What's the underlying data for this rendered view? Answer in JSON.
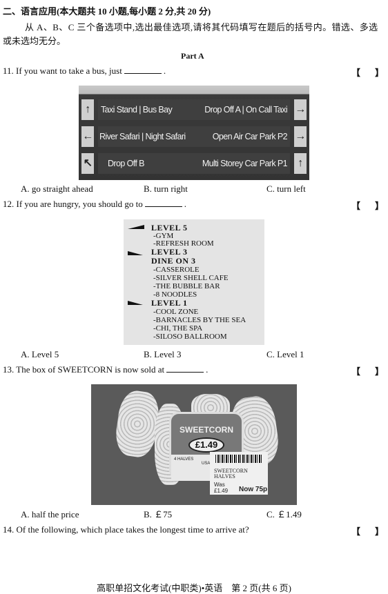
{
  "section_title": "二、语言应用(本大题共 10 小题,每小题 2 分,共 20 分)",
  "instructions": [
    "从 A、B、C 三个备选项中,选出最佳选项,请将其代码填写在题后的括号内。错选、多选",
    "或未选均无分。"
  ],
  "part_label": "Part A",
  "bracket_open": "【",
  "bracket_close": "】",
  "questions": [
    {
      "stem": "11. If you want to take a bus, just",
      "end": ".",
      "options": [
        "A. go straight ahead",
        "B. turn right",
        "C. turn left"
      ]
    },
    {
      "stem": "12. If you are hungry, you should go to",
      "end": ".",
      "options": [
        "A. Level 5",
        "B. Level 3",
        "C. Level 1"
      ]
    },
    {
      "stem": "13. The box of SWEETCORN is now sold at",
      "end": ".",
      "options": [
        "A. half the price",
        "B. ￡75",
        "C. ￡1.49"
      ]
    },
    {
      "stem": "14. Of the following, which place takes the longest time to arrive at?"
    }
  ],
  "sign": {
    "row1_left": "Taxi Stand | Bus Bay",
    "row1_right": "Drop Off A | On Call Taxi",
    "row2_left": "River Safari | Night Safari",
    "row2_right": "Open Air Car Park P2",
    "row3_left": "Drop Off B",
    "row3_right": "Multi Storey Car Park P1",
    "arrows": [
      "↑",
      "→",
      "←",
      "→",
      "↖",
      "↑"
    ]
  },
  "directory": {
    "lines": [
      "LEVEL 5",
      "-GYM",
      "-REFRESH ROOM",
      "LEVEL 3",
      "DINE ON 3",
      "-CASSEROLE",
      "-SILVER SHELL CAFE",
      "-THE BUBBLE BAR",
      "-8 NOODLES",
      "LEVEL 1",
      "-COOL ZONE",
      "-BARNACLES BY THE SEA",
      "-CHI, THE SPA",
      "-SILOSO BALLROOM"
    ]
  },
  "product": {
    "name": "SWEETCORN",
    "price": "£1.49",
    "pack_text": "4 HALVES",
    "origin": "USA",
    "label_name": "SWEETCORN HALVES",
    "was_label": "Was",
    "was_price": "£1.49",
    "now_price": "Now 75p"
  },
  "footer": "高职单招文化考试(中职类)•英语　第 2 页(共 6 页)"
}
